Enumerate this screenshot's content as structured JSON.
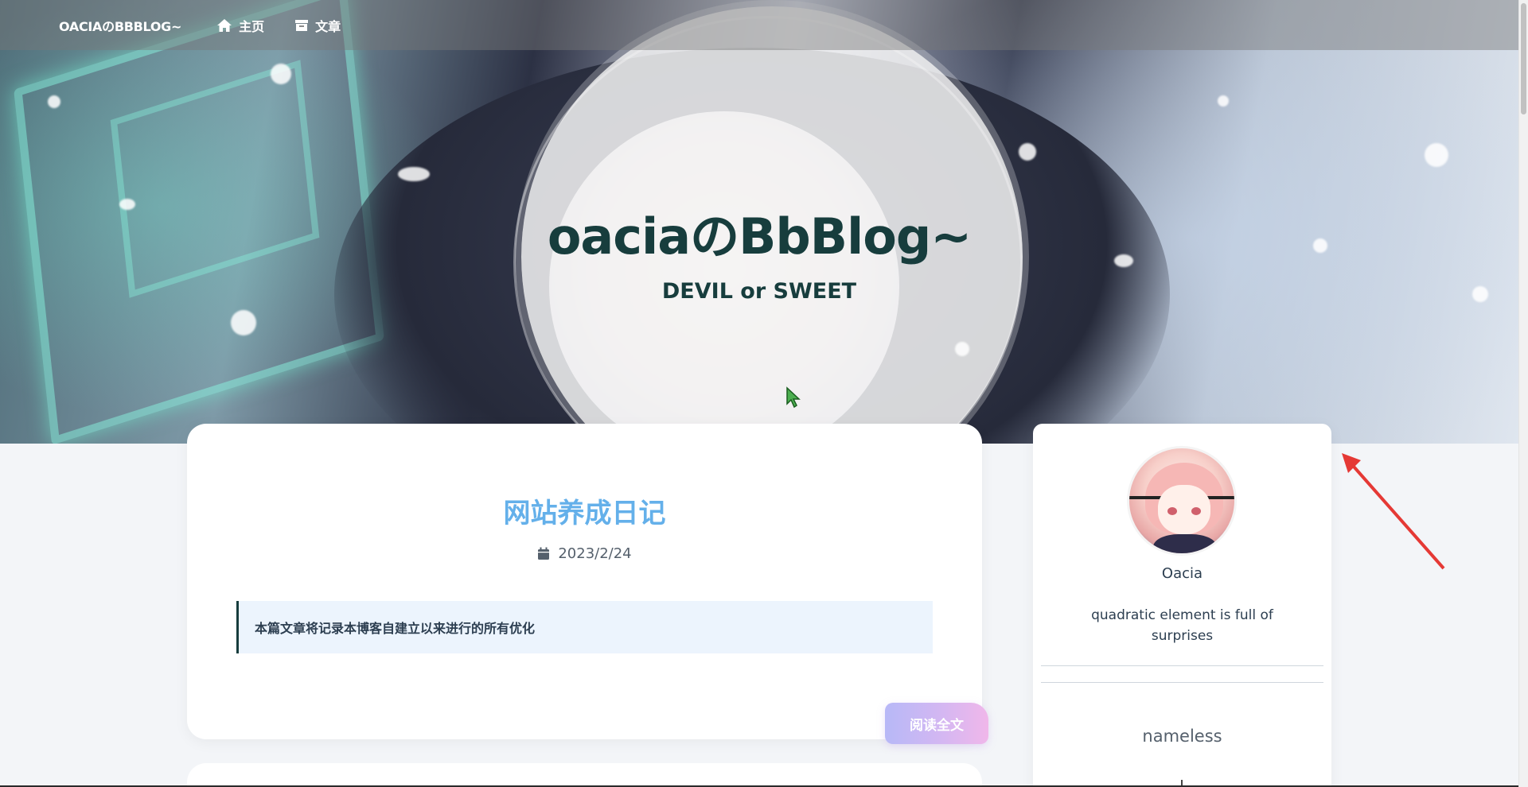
{
  "nav": {
    "brand": "OACIAのBBBLOG~",
    "items": [
      {
        "label": "主页",
        "icon": "home-icon"
      },
      {
        "label": "文章",
        "icon": "archive-icon"
      }
    ]
  },
  "hero": {
    "title": "oaciaのBbBlog~",
    "subtitle": "DEVIL or SWEET"
  },
  "post": {
    "title": "网站养成日记",
    "date": "2023/2/24",
    "date_icon": "calendar-icon",
    "excerpt": "本篇文章将记录本博客自建立以来进行的所有优化",
    "read_more": "阅读全文"
  },
  "sidebar": {
    "name": "Oacia",
    "description": "quadratic element is full of surprises",
    "section_title": "nameless"
  },
  "colors": {
    "accent_title": "#64b0ea",
    "brand_dark": "#173d3d",
    "excerpt_bg": "#ecf4fd",
    "annotation_arrow": "#e53935"
  }
}
